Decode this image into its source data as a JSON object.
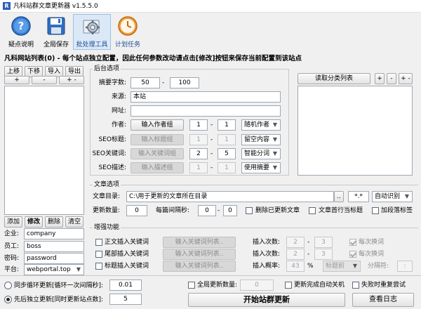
{
  "window": {
    "title": "凡科站群文章更新器 v1.5.5.0"
  },
  "toolbar": {
    "items": [
      {
        "label": "疑点说明"
      },
      {
        "label": "全局保存"
      },
      {
        "label": "批处理工具"
      },
      {
        "label": "计划任务"
      }
    ]
  },
  "notice": "凡科网站列表(0) - 每个站点独立配置，因此任何参数改动请点击[修改]按钮来保存当前配置到该站点",
  "site_list": {
    "nav_buttons": [
      "上移",
      "下移",
      "导入",
      "导出"
    ],
    "small_buttons": [
      "+",
      "-",
      "+ -"
    ],
    "actions": [
      "添加",
      "修改",
      "删除",
      "清空"
    ],
    "enterprise_label": "企业:",
    "enterprise_value": "company",
    "employee_label": "员工:",
    "employee_value": "boss",
    "password_label": "密码:",
    "password_value": "password",
    "platform_label": "平台:",
    "platform_value": "webportal.top"
  },
  "backend": {
    "title": "后台选项",
    "summary_label": "摘要字数:",
    "summary_min": "50",
    "summary_max": "100",
    "dash": "-",
    "source_label": "来源:",
    "source_value": "本站",
    "url_label": "网址:",
    "url_value": "",
    "author_label": "作者:",
    "author_button": "输入作者组",
    "author_min": "1",
    "author_max": "1",
    "author_mode": "随机作者",
    "seo_title_label": "SEO标题:",
    "seo_title_button": "输入标题组",
    "seo_title_min": "1",
    "seo_title_max": "1",
    "seo_title_mode": "留空内容",
    "seo_kw_label": "SEO关键词:",
    "seo_kw_button": "输入关键词组",
    "seo_kw_min": "2",
    "seo_kw_max": "5",
    "seo_kw_mode": "智能分词",
    "seo_desc_label": "SEO描述:",
    "seo_desc_button": "输入描述组",
    "seo_desc_min": "1",
    "seo_desc_max": "1",
    "seo_desc_mode": "使用摘要"
  },
  "category": {
    "read_button": "读取分类列表",
    "small_buttons": [
      "+",
      "-",
      "+ -"
    ]
  },
  "article": {
    "title": "文章选项",
    "dir_label": "文章目录:",
    "dir_value": "C:\\用于更新的文章所在目录",
    "browse": "..",
    "ext_value": "*.*",
    "encoding": "自动识别",
    "update_count_label": "更新数量:",
    "update_count": "0",
    "interval_label": "每篇间隔秒:",
    "interval_min": "0",
    "interval_max": "0",
    "opt_delete": "删除已更新文章",
    "opt_first_line_title": "文章首行当标题",
    "opt_tags": "加段落标签"
  },
  "enhance": {
    "title": "增强功能",
    "rows": [
      {
        "label": "正文插入关键词",
        "button": "输入关键词列表..",
        "count_label": "插入次数:",
        "min": "2",
        "max": "3",
        "each": "每次换词"
      },
      {
        "label": "尾部插入关键词",
        "button": "输入关键词列表..",
        "count_label": "插入次数:",
        "min": "2",
        "max": "3",
        "each": "每次换词"
      },
      {
        "label": "标题插入关键词",
        "button": "输入关键词列表..",
        "count_label": "插入概率:",
        "prob": "43",
        "pct": "%",
        "position": "标题前",
        "sep_label": "分隔符:",
        "sep_value": ":"
      }
    ]
  },
  "bottom": {
    "loop_label": "同步循环更新[循环一次间隔秒]:",
    "loop_value": "0.01",
    "seq_label": "先后独立更新[同时更新站点数]:",
    "seq_value": "5",
    "global_count_label": "全局更新数量:",
    "global_count_value": "0",
    "shutdown_label": "更新完成自动关机",
    "retry_label": "失败时重复尝试",
    "start_button": "开始站群更新",
    "log_button": "查看日志"
  }
}
